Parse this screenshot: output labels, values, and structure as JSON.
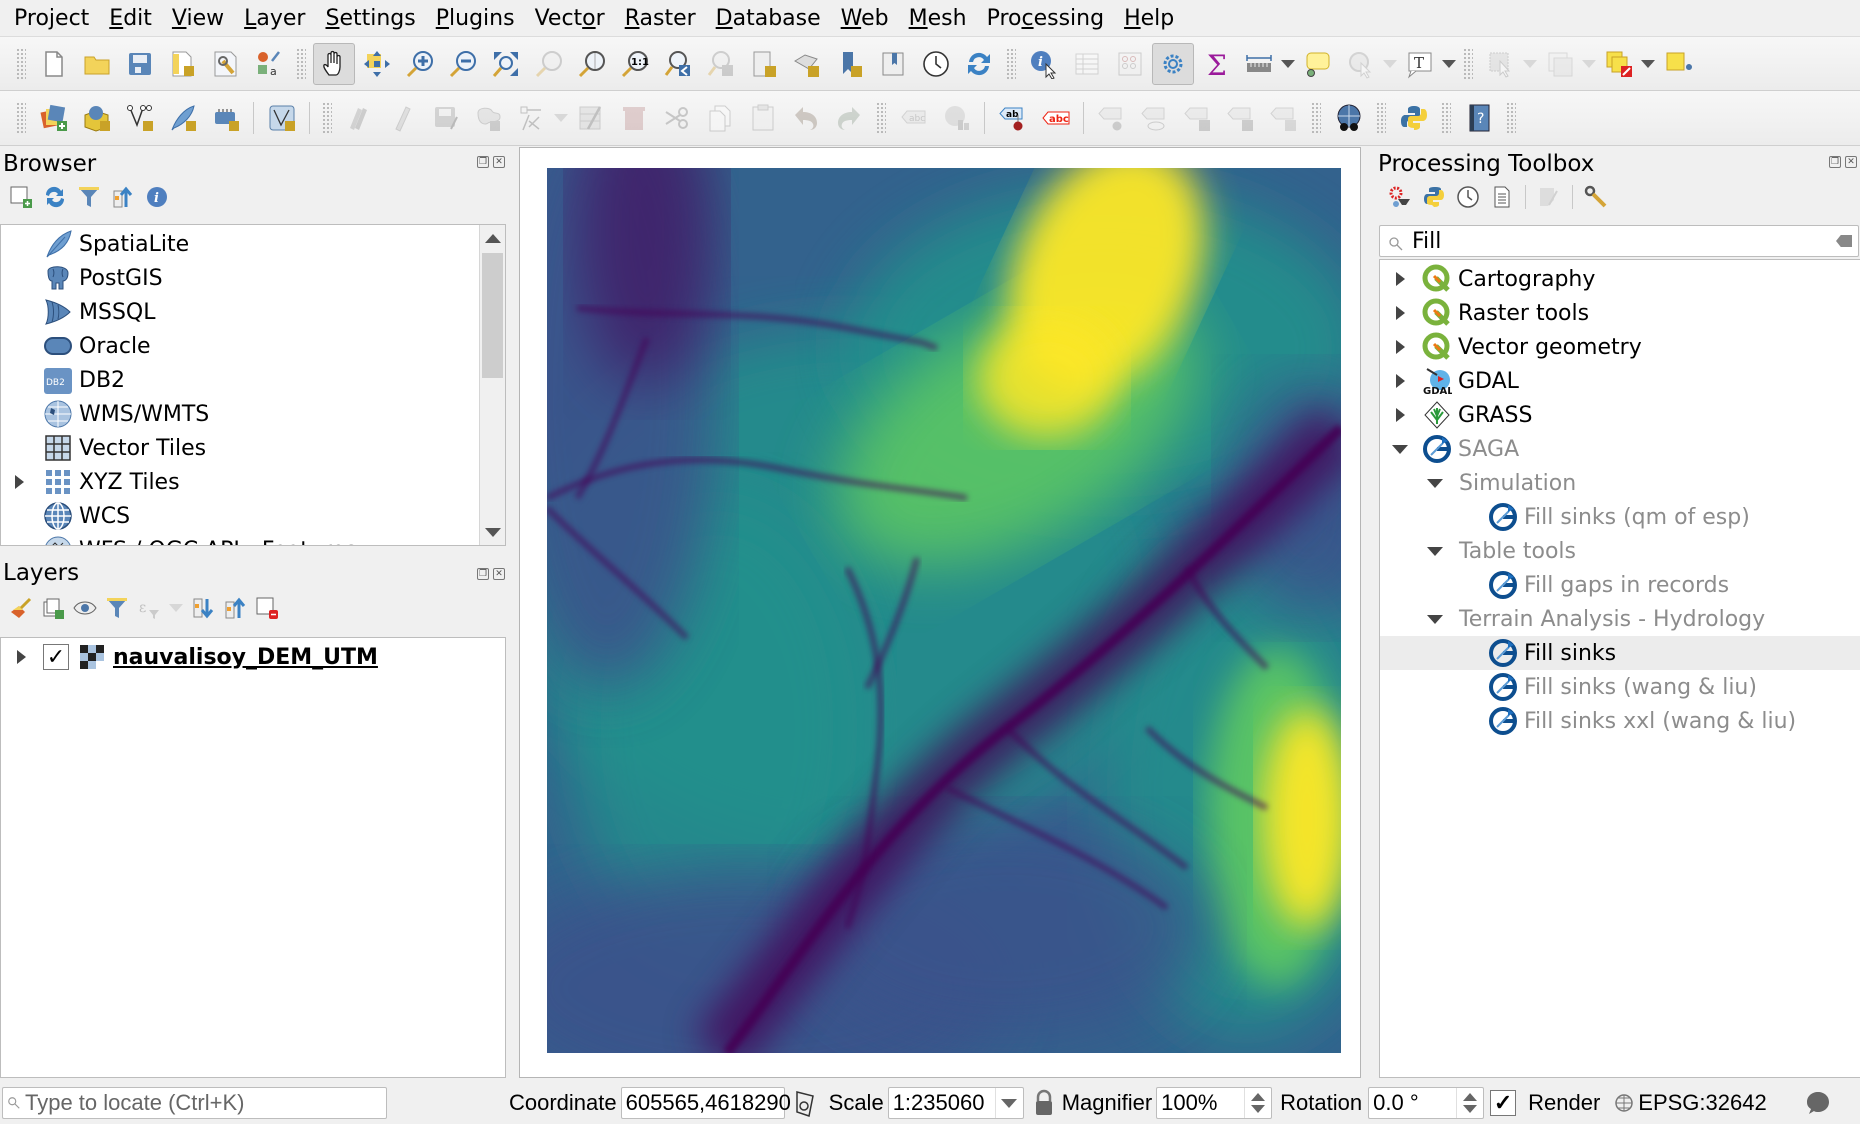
{
  "menubar": {
    "items": [
      {
        "label": "Project",
        "mnemonic_index": 3
      },
      {
        "label": "Edit",
        "mnemonic_index": 0
      },
      {
        "label": "View",
        "mnemonic_index": 0
      },
      {
        "label": "Layer",
        "mnemonic_index": 0
      },
      {
        "label": "Settings",
        "mnemonic_index": 0
      },
      {
        "label": "Plugins",
        "mnemonic_index": 0
      },
      {
        "label": "Vector",
        "mnemonic_index": 4
      },
      {
        "label": "Raster",
        "mnemonic_index": 0
      },
      {
        "label": "Database",
        "mnemonic_index": 0
      },
      {
        "label": "Web",
        "mnemonic_index": 0
      },
      {
        "label": "Mesh",
        "mnemonic_index": 0
      },
      {
        "label": "Processing",
        "mnemonic_index": 3
      },
      {
        "label": "Help",
        "mnemonic_index": 0
      }
    ]
  },
  "toolbar1": {
    "buttons": [
      "new-project",
      "open-project",
      "save-project",
      "new-print-layout",
      "layout-manager",
      "style-manager",
      "pan-map",
      "pan-to-selection",
      "zoom-in",
      "zoom-out",
      "zoom-full",
      "zoom-to-selection",
      "zoom-to-layer",
      "zoom-native",
      "zoom-last",
      "zoom-next",
      "new-map-view",
      "new-3d-map-view",
      "new-spatial-bookmark",
      "show-bookmarks",
      "temporal-controller",
      "refresh",
      "identify-features",
      "open-attribute-table",
      "open-field-calculator",
      "processing-toolbox",
      "show-statistical-summary",
      "measure-line",
      "text-annotation",
      "map-tips",
      "text-annotation-tool",
      "select-features",
      "deselect",
      "select-by-location",
      "add-vertex"
    ]
  },
  "toolbar2": {
    "buttons": [
      "data-source-manager",
      "new-geopackage-layer",
      "new-shapefile-layer",
      "new-spatialite-layer",
      "new-virtual-layer",
      "vertex-tool",
      "current-edits",
      "toggle-editing",
      "save-edits",
      "add-polygon",
      "digitize",
      "attribute-table",
      "delete-selected",
      "cut",
      "copy",
      "paste",
      "undo",
      "redo",
      "layer-labeling",
      "layer-diagram",
      "pin-labels",
      "highlight-pinned-labels",
      "toggle-label-display",
      "move-label",
      "rotate-label",
      "change-label",
      "metasearch",
      "python-console",
      "help"
    ]
  },
  "browser": {
    "title": "Browser",
    "items": [
      {
        "label": "SpatiaLite",
        "icon": "spatialite-icon",
        "expandable": false
      },
      {
        "label": "PostGIS",
        "icon": "postgis-icon",
        "expandable": false
      },
      {
        "label": "MSSQL",
        "icon": "mssql-icon",
        "expandable": false
      },
      {
        "label": "Oracle",
        "icon": "oracle-icon",
        "expandable": false
      },
      {
        "label": "DB2",
        "icon": "db2-icon",
        "expandable": false
      },
      {
        "label": "WMS/WMTS",
        "icon": "wms-icon",
        "expandable": false
      },
      {
        "label": "Vector Tiles",
        "icon": "vector-tiles-icon",
        "expandable": false
      },
      {
        "label": "XYZ Tiles",
        "icon": "xyz-tiles-icon",
        "expandable": true
      },
      {
        "label": "WCS",
        "icon": "wcs-icon",
        "expandable": false
      },
      {
        "label": "WFS / OGC API - Features",
        "icon": "wfs-icon",
        "expandable": false
      }
    ],
    "db2_badge": "DB2"
  },
  "layers": {
    "title": "Layers",
    "items": [
      {
        "label": "nauvalisoy_DEM_UTM",
        "checked": true,
        "expandable": true
      }
    ]
  },
  "toolbox": {
    "title": "Processing Toolbox",
    "search_value": "Fill",
    "tree": [
      {
        "label": "Cartography",
        "level": 0,
        "icon": "qgis-icon",
        "state": "collapsed",
        "enabled": true
      },
      {
        "label": "Raster tools",
        "level": 0,
        "icon": "qgis-icon",
        "state": "collapsed",
        "enabled": true
      },
      {
        "label": "Vector geometry",
        "level": 0,
        "icon": "qgis-icon",
        "state": "collapsed",
        "enabled": true
      },
      {
        "label": "GDAL",
        "level": 0,
        "icon": "gdal-icon",
        "state": "collapsed",
        "enabled": true
      },
      {
        "label": "GRASS",
        "level": 0,
        "icon": "grass-icon",
        "state": "collapsed",
        "enabled": true
      },
      {
        "label": "SAGA",
        "level": 0,
        "icon": "saga-icon",
        "state": "expanded",
        "enabled": false
      },
      {
        "label": "Simulation",
        "level": 1,
        "icon": "",
        "state": "expanded",
        "enabled": false
      },
      {
        "label": "Fill sinks (qm of esp)",
        "level": 2,
        "icon": "saga-icon",
        "state": "leaf",
        "enabled": false
      },
      {
        "label": "Table tools",
        "level": 1,
        "icon": "",
        "state": "expanded",
        "enabled": false
      },
      {
        "label": "Fill gaps in records",
        "level": 2,
        "icon": "saga-icon",
        "state": "leaf",
        "enabled": false
      },
      {
        "label": "Terrain Analysis - Hydrology",
        "level": 1,
        "icon": "",
        "state": "expanded",
        "enabled": false
      },
      {
        "label": "Fill sinks",
        "level": 2,
        "icon": "saga-icon",
        "state": "leaf",
        "enabled": true,
        "selected": true
      },
      {
        "label": "Fill sinks (wang & liu)",
        "level": 2,
        "icon": "saga-icon",
        "state": "leaf",
        "enabled": false
      },
      {
        "label": "Fill sinks xxl (wang & liu)",
        "level": 2,
        "icon": "saga-icon",
        "state": "leaf",
        "enabled": false
      }
    ]
  },
  "map": {
    "layer_name": "nauvalisoy_DEM_UTM",
    "colormap": "viridis",
    "colors": {
      "low": "#440154",
      "mid_low": "#3b528b",
      "mid": "#21918c",
      "mid_high": "#5ec962",
      "high": "#fde725"
    }
  },
  "statusbar": {
    "locate_placeholder": "Type to locate (Ctrl+K)",
    "coordinate_label": "Coordinate",
    "coordinate_value": "605565,4618290",
    "scale_label": "Scale",
    "scale_value": "1:235060",
    "magnifier_label": "Magnifier",
    "magnifier_value": "100%",
    "rotation_label": "Rotation",
    "rotation_value": "0.0 °",
    "render_label": "Render",
    "render_checked": true,
    "crs_label": "EPSG:32642"
  }
}
